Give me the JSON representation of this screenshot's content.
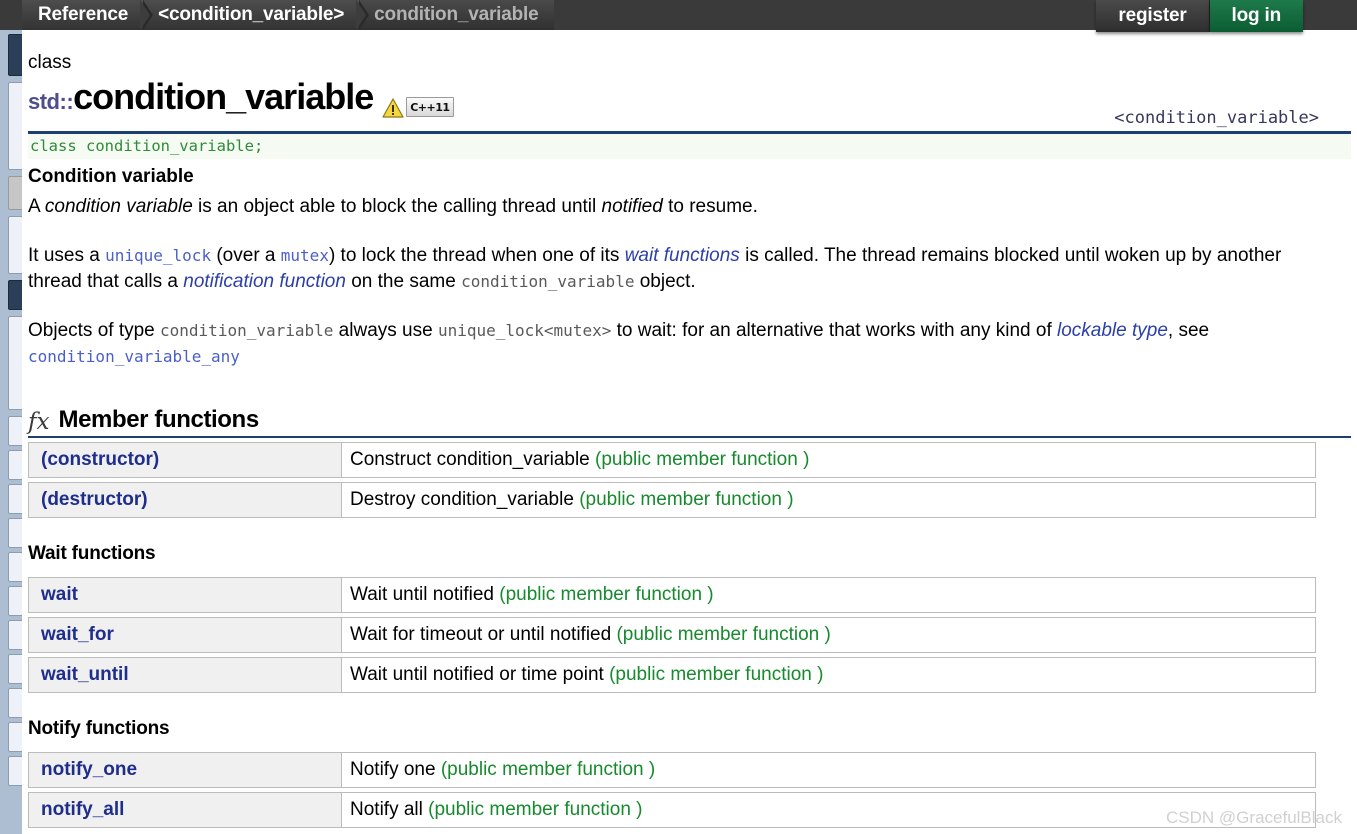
{
  "topbar": {
    "breadcrumb": [
      {
        "label": "Reference",
        "current": false
      },
      {
        "label": "<condition_variable>",
        "current": false
      },
      {
        "label": "condition_variable",
        "current": true
      }
    ],
    "register_label": "register",
    "login_label": "log in"
  },
  "header": {
    "kind": "class",
    "namespace": "std::",
    "name": "condition_variable",
    "warning_icon": "warning-triangle-icon",
    "std_badge": "C++11",
    "header_file": "<condition_variable>",
    "declaration": "class condition_variable;"
  },
  "intro": {
    "subtitle": "Condition variable",
    "p1": {
      "a": "A ",
      "b": "condition variable",
      "c": " is an object able to block the calling thread until ",
      "d": "notified",
      "e": " to resume."
    },
    "p2": {
      "a": "It uses a ",
      "b": "unique_lock",
      "c": " (over a ",
      "d": "mutex",
      "e": ") to lock the thread when one of its ",
      "f": "wait functions",
      "g": " is called. The thread remains blocked until woken up by another thread that calls a ",
      "h": "notification function",
      "i": " on the same ",
      "j": "condition_variable",
      "k": " object."
    },
    "p3": {
      "a": "Objects of type ",
      "b": "condition_variable",
      "c": " always use ",
      "d": "unique_lock<mutex>",
      "e": " to wait: for an alternative that works with any kind of ",
      "f": "lockable type",
      "g": ", see ",
      "h": "condition_variable_any"
    }
  },
  "sections": {
    "member_functions": {
      "icon": "fx-icon",
      "icon_glyph": "fx",
      "title": "Member functions",
      "rows": [
        {
          "name": "(constructor)",
          "desc": "Construct condition_variable ",
          "note": "(public member function )"
        },
        {
          "name": "(destructor)",
          "desc": "Destroy condition_variable ",
          "note": "(public member function )"
        }
      ]
    },
    "wait_functions": {
      "title": "Wait functions",
      "rows": [
        {
          "name": "wait",
          "desc": "Wait until notified ",
          "note": "(public member function )"
        },
        {
          "name": "wait_for",
          "desc": "Wait for timeout or until notified ",
          "note": "(public member function )"
        },
        {
          "name": "wait_until",
          "desc": "Wait until notified or time point ",
          "note": "(public member function )"
        }
      ]
    },
    "notify_functions": {
      "title": "Notify functions",
      "rows": [
        {
          "name": "notify_one",
          "desc": "Notify one ",
          "note": "(public member function )"
        },
        {
          "name": "notify_all",
          "desc": "Notify all ",
          "note": "(public member function )"
        }
      ]
    }
  },
  "watermark": "CSDN @GracefulBlack",
  "colors": {
    "accent_rule": "#1c3f72",
    "link": "#2b3fa8",
    "note_green": "#168a2d",
    "code_green": "#2e8b3a",
    "login_green": "#0c5c33"
  }
}
